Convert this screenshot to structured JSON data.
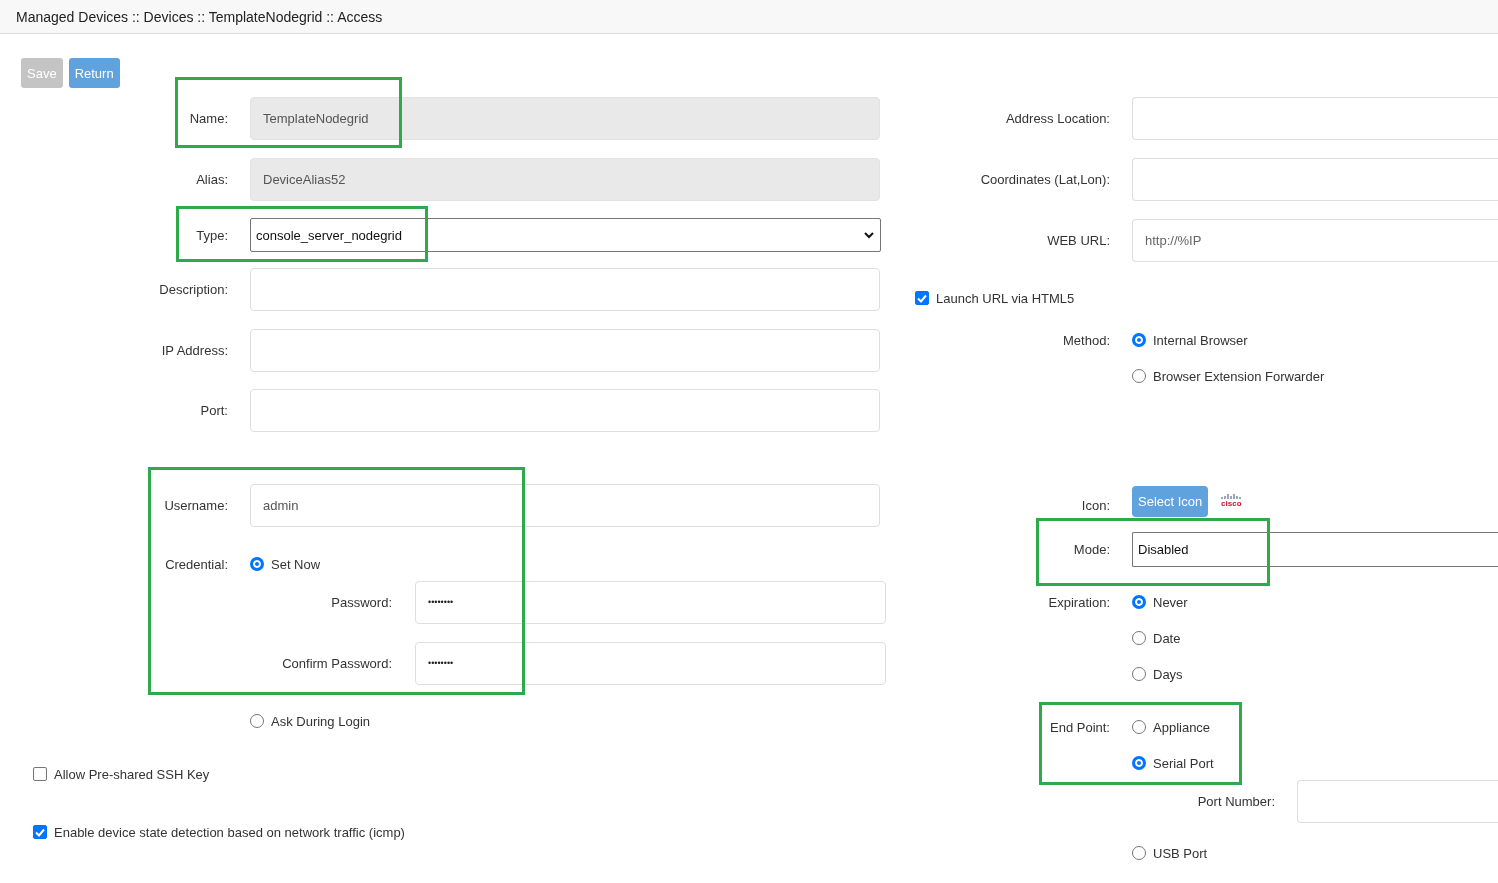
{
  "breadcrumb": "Managed Devices :: Devices :: TemplateNodegrid :: Access",
  "buttons": [
    {
      "label": "Save",
      "disabled": true
    },
    {
      "label": "Return",
      "disabled": false
    }
  ],
  "name": {
    "label": "Name:",
    "value": "TemplateNodegrid",
    "readonly": true,
    "highlighted": true
  },
  "alias": {
    "label": "Alias:",
    "value": "DeviceAlias52",
    "readonly": true
  },
  "type": {
    "label": "Type:",
    "value": "console_server_nodegrid",
    "highlighted": true
  },
  "description": {
    "label": "Description:"
  },
  "ip_address": {
    "label": "IP Address:"
  },
  "port": {
    "label": "Port:"
  },
  "username": {
    "label": "Username:",
    "value": "admin",
    "highlighted": true
  },
  "credential": {
    "label": "Credential:",
    "options": [
      {
        "label": "Set Now",
        "selected": true,
        "sub_fields": [
          {
            "label": "Password:",
            "value": "••••••••"
          },
          {
            "label": "Confirm Password:",
            "value": "••••••••"
          }
        ]
      },
      {
        "label": "Ask During Login",
        "selected": false
      }
    ]
  },
  "allow_ssh_key": {
    "label": "Allow Pre-shared SSH Key",
    "checked": false
  },
  "enable_detection": {
    "label": "Enable device state detection based on network traffic (icmp)",
    "checked": true
  },
  "address_location": {
    "label": "Address Location:"
  },
  "coordinates": {
    "label": "Coordinates (Lat,Lon):"
  },
  "web_url": {
    "label": "WEB URL:",
    "placeholder": "http://%IP"
  },
  "launch_html5": {
    "label": "Launch URL via HTML5",
    "checked": true
  },
  "method": {
    "label": "Method:",
    "options": [
      {
        "label": "Internal Browser",
        "selected": true
      },
      {
        "label": "Browser Extension Forwarder",
        "selected": false
      }
    ]
  },
  "icon": {
    "label": "Icon:",
    "button": "Select Icon",
    "logo_text": "cisco"
  },
  "mode": {
    "label": "Mode:",
    "value": "Disabled",
    "highlighted": true
  },
  "expiration": {
    "label": "Expiration:",
    "options": [
      {
        "label": "Never",
        "selected": true
      },
      {
        "label": "Date",
        "selected": false
      },
      {
        "label": "Days",
        "selected": false
      }
    ]
  },
  "end_point": {
    "label": "End Point:",
    "highlighted": true,
    "options": [
      {
        "label": "Appliance",
        "selected": false
      },
      {
        "label": "Serial Port",
        "selected": true,
        "sub_field": {
          "label": "Port Number:"
        }
      },
      {
        "label": "USB Port",
        "selected": false
      }
    ]
  }
}
